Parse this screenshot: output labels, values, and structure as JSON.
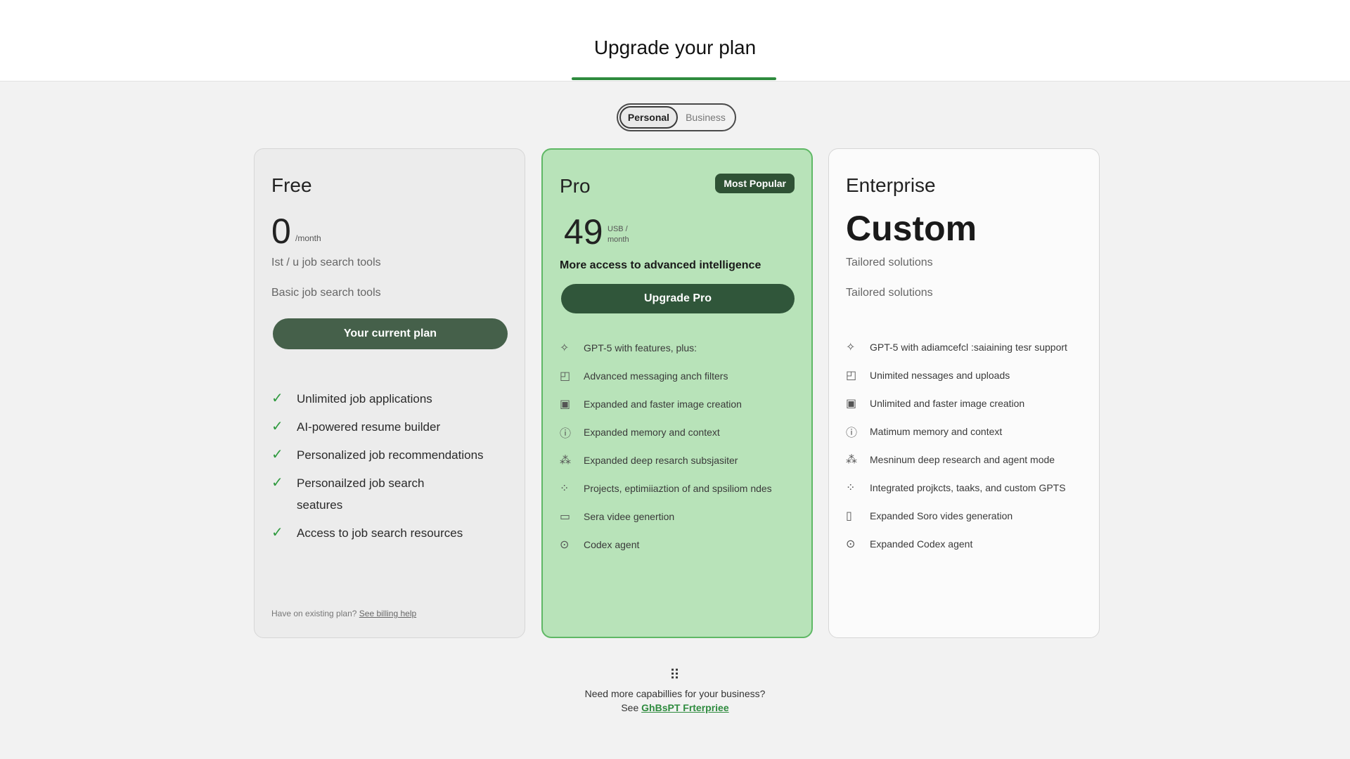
{
  "header": {
    "title": "Upgrade your plan"
  },
  "toggle": {
    "personal": "Personal",
    "business": "Business"
  },
  "plans": {
    "free": {
      "name": "Free",
      "price": "0",
      "unit": "/month",
      "line1": "Ist / u job search tools",
      "line2": "Basic job search tools",
      "button": "Your current plan",
      "features": [
        "Unlimited job applications",
        "AI-powered resume builder",
        "Personalized job recommendations",
        "Personailzed job search seatures",
        "Access to job search resources"
      ],
      "billing_text": "Have on existing plan?",
      "billing_link": "See billing help"
    },
    "pro": {
      "name": "Pro",
      "badge": "Most Popular",
      "price": "49",
      "unit_line1": "USB /",
      "unit_line2": "month",
      "tagline": "More access to advanced intelligence",
      "button": "Upgrade Pro",
      "features": [
        "GPT-5 with features, plus:",
        "Advanced messaging anch filters",
        "Expanded and faster image creation",
        "Expanded memory and context",
        "Expanded deep resarch subsjasiter",
        "Projects, eptimiiaztion of and spsiliom ndes",
        "Sera videe genertion",
        "Codex agent"
      ]
    },
    "enterprise": {
      "name": "Enterprise",
      "price": "Custom",
      "line1": "Tailored solutions",
      "line2": "Tailored solutions",
      "features": [
        "GPT-5 with adiamcefcl :saiaining tesr support",
        "Unimited nessages and uploads",
        "Unlimited and faster image creation",
        "Matimum memory and context",
        "Mesninum deep research and agent mode",
        "Integrated projkcts, taaks, and custom GPTS",
        "Expanded Soro vides generation",
        "Expanded Codex agent"
      ]
    }
  },
  "footer": {
    "need": "Need more capabillies for your business?",
    "see": "See",
    "link": "GhBsPT Frterpriee"
  },
  "icons": {
    "pro": [
      "sparkle-icon",
      "chat-bubble-icon",
      "image-icon",
      "memory-icon",
      "research-icon",
      "projects-icon",
      "video-icon",
      "codex-icon"
    ],
    "enterprise": [
      "sparkle-icon",
      "chat-bubble-icon",
      "image-icon",
      "memory-icon",
      "research-icon",
      "projects-icon",
      "video-icon",
      "codex-icon"
    ]
  },
  "colors": {
    "accent": "#2e8b3e",
    "pro_bg": "#b8e3b9",
    "button": "#3e5a42"
  }
}
